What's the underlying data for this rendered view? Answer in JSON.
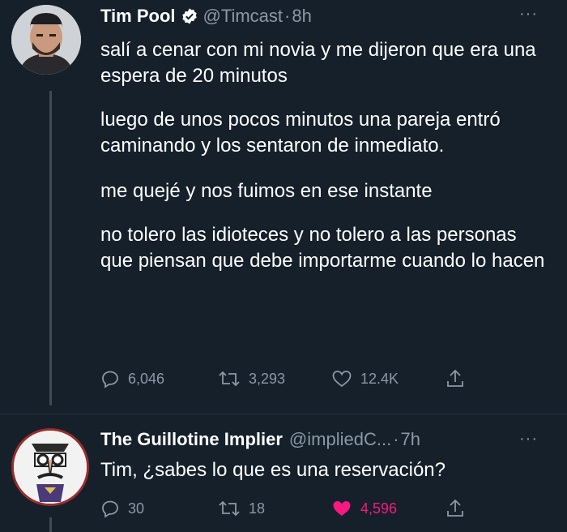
{
  "tweet": {
    "author_name": "Tim Pool",
    "handle": "@Timcast",
    "time": "8h",
    "more": "···",
    "paragraphs": [
      "salí a cenar con mi novia y me dijeron que era una espera de 20 minutos",
      "luego de unos pocos minutos una pareja entró caminando y los sentaron de inmediato.",
      "me quejé y nos fuimos en ese instante",
      "no tolero las idioteces y no tolero a las personas que piensan que debe importarme cuando lo hacen"
    ],
    "stats": {
      "replies": "6,046",
      "retweets": "3,293",
      "likes": "12.4K"
    }
  },
  "reply": {
    "author_name": "The Guillotine Implier",
    "handle": "@impliedC...",
    "time": "7h",
    "more": "···",
    "text": "Tim, ¿sabes lo que es una reservación?",
    "stats": {
      "replies": "30",
      "retweets": "18",
      "likes": "4,596"
    },
    "liked": true
  },
  "colors": {
    "background": "#15202b",
    "secondary_text": "#8b98a5",
    "like_active": "#f91880",
    "thread_line": "#3d4a57"
  },
  "icons": [
    "verified-badge-icon",
    "reply-icon",
    "retweet-icon",
    "like-icon",
    "share-icon",
    "more-icon"
  ]
}
